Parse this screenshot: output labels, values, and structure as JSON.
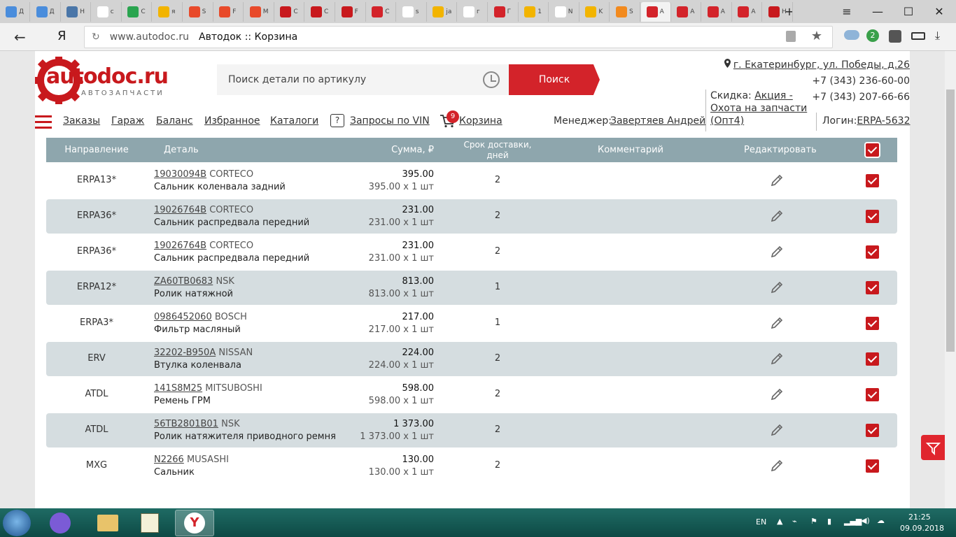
{
  "browser": {
    "tabs": [
      {
        "label": "Д",
        "color": "#4a8ddc"
      },
      {
        "label": "Д",
        "color": "#4a8ddc"
      },
      {
        "label": "Н",
        "color": "#4a76a8"
      },
      {
        "label": "с",
        "color": "#ffffff"
      },
      {
        "label": "С",
        "color": "#2aa44f"
      },
      {
        "label": "я",
        "color": "#f2b400"
      },
      {
        "label": "S",
        "color": "#e84a2a"
      },
      {
        "label": "F",
        "color": "#e84a2a"
      },
      {
        "label": "М",
        "color": "#e84a2a"
      },
      {
        "label": "С",
        "color": "#c8191d"
      },
      {
        "label": "С",
        "color": "#c8191d"
      },
      {
        "label": "F",
        "color": "#c8191d"
      },
      {
        "label": "С",
        "color": "#d3232a"
      },
      {
        "label": "s",
        "color": "#ffffff"
      },
      {
        "label": "ja",
        "color": "#f2b400"
      },
      {
        "label": "г",
        "color": "#ffffff"
      },
      {
        "label": "Г",
        "color": "#d3232a"
      },
      {
        "label": "1",
        "color": "#f2b400"
      },
      {
        "label": "N",
        "color": "#ffffff"
      },
      {
        "label": "K",
        "color": "#f2b400"
      },
      {
        "label": "S",
        "color": "#f28a1e"
      },
      {
        "label": "A",
        "color": "#d3232a"
      },
      {
        "label": "A",
        "color": "#d3232a"
      },
      {
        "label": "A",
        "color": "#d3232a"
      },
      {
        "label": "A",
        "color": "#d3232a"
      },
      {
        "label": "H",
        "color": "#c8191d"
      }
    ],
    "new_tab": "+",
    "menu_icon": "≡",
    "minimize": "—",
    "maximize": "☐",
    "close": "✕",
    "back": "←",
    "home_logo": "Я",
    "url": "www.autodoc.ru",
    "page_title": "Автодок :: Корзина",
    "notif_count": "2",
    "cloud_badge": "9"
  },
  "header": {
    "logo_text": "autodoc.ru",
    "logo_sub": "АВТОЗАПЧАСТИ",
    "search_placeholder": "Поиск детали по артикулу",
    "search_button": "Поиск",
    "address": "г. Екатеринбург, ул. Победы, д.26",
    "phone1": "+7 (343) 236-60-00",
    "phone2": "+7 (343) 207-66-66",
    "discount_label": "Скидка:",
    "discount_link1": "Акция -",
    "discount_link2": "Охота на запчасти",
    "discount_link3": "(Опт4)"
  },
  "nav": {
    "orders": "Заказы",
    "garage": "Гараж",
    "balance": "Баланс",
    "favorites": "Избранное",
    "catalogs": "Каталоги",
    "vin": "Запросы по VIN",
    "cart": "Корзина",
    "cart_count": "9",
    "manager_label": "Менеджер:",
    "manager_name": "Завертяев Андрей",
    "login_label": "Логин:",
    "login_value": "ERPA-5632"
  },
  "table": {
    "headers": {
      "direction": "Направление",
      "detail": "Деталь",
      "sum": "Сумма, ₽",
      "days": "Срок доставки, дней",
      "comment": "Комментарий",
      "edit": "Редактировать"
    },
    "rows": [
      {
        "dir": "ERPA13*",
        "art": "19030094B",
        "brand": "CORTECO",
        "name": "Сальник коленвала задний",
        "total": "395.00",
        "per": "395.00 x 1 шт",
        "days": "2"
      },
      {
        "dir": "ERPA36*",
        "art": "19026764B",
        "brand": "CORTECO",
        "name": "Сальник распредвала передний",
        "total": "231.00",
        "per": "231.00 x 1 шт",
        "days": "2"
      },
      {
        "dir": "ERPA36*",
        "art": "19026764B",
        "brand": "CORTECO",
        "name": "Сальник распредвала передний",
        "total": "231.00",
        "per": "231.00 x 1 шт",
        "days": "2"
      },
      {
        "dir": "ERPA12*",
        "art": "ZA60TB0683",
        "brand": "NSK",
        "name": "Ролик натяжной",
        "total": "813.00",
        "per": "813.00 x 1 шт",
        "days": "1"
      },
      {
        "dir": "ERPA3*",
        "art": "0986452060",
        "brand": "BOSCH",
        "name": "Фильтр масляный",
        "total": "217.00",
        "per": "217.00 x 1 шт",
        "days": "1"
      },
      {
        "dir": "ERV",
        "art": "32202-B950A",
        "brand": "NISSAN",
        "name": "Втулка коленвала",
        "total": "224.00",
        "per": "224.00 x 1 шт",
        "days": "2"
      },
      {
        "dir": "ATDL",
        "art": "141S8M25",
        "brand": "MITSUBOSHI",
        "name": "Ремень ГРМ",
        "total": "598.00",
        "per": "598.00 x 1 шт",
        "days": "2"
      },
      {
        "dir": "ATDL",
        "art": "56TB2801B01",
        "brand": "NSK",
        "name": "Ролик натяжителя приводного ремня",
        "total": "1 373.00",
        "per": "1 373.00 x 1 шт",
        "days": "2"
      },
      {
        "dir": "MXG",
        "art": "N2266",
        "brand": "MUSASHI",
        "name": "Сальник",
        "total": "130.00",
        "per": "130.00 x 1 шт",
        "days": "2"
      }
    ]
  },
  "taskbar": {
    "lang": "EN",
    "time": "21:25",
    "date": "09.09.2018"
  }
}
